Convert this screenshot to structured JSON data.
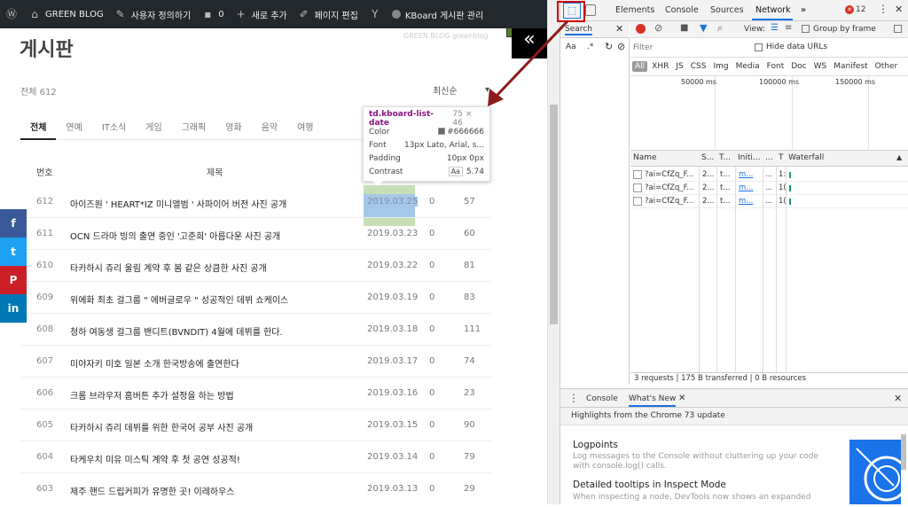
{
  "adminbar": {
    "items": [
      {
        "icon": "wordpress-icon",
        "label": ""
      },
      {
        "icon": "home-icon",
        "label": "GREEN BLOG"
      },
      {
        "icon": "brush-icon",
        "label": "사용자 정의하기"
      },
      {
        "icon": "comment-icon",
        "label": "0"
      },
      {
        "icon": "plus-icon",
        "label": "새로 추가"
      },
      {
        "icon": "pencil-icon",
        "label": "페이지 편집"
      },
      {
        "icon": "yoast-icon",
        "label": ""
      },
      {
        "icon": "dot-icon",
        "label": "KBoard 게시판 관리"
      }
    ]
  },
  "page": {
    "title": "게시판",
    "subtitle": "GREEN BLOG greenblog",
    "logo_glyph": "«",
    "total": "전체 612",
    "sort_label": "최신순",
    "sort_arrow": "▾",
    "tabs": [
      "전체",
      "연예",
      "IT소식",
      "게임",
      "그래픽",
      "영화",
      "음악",
      "여행"
    ],
    "table_headers": {
      "num": "번호",
      "title": "제목"
    },
    "rows": [
      {
        "num": "612",
        "title": "아이즈원 ' HEART*IZ 미니앨범 ' 사파이어 버전 사진 공개",
        "date": "2019.03.25",
        "views": "0",
        "likes": "57"
      },
      {
        "num": "611",
        "title": "OCN 드라마 빙의 출연 중인 '고준희' 아름다운 사진 공개",
        "date": "2019.03.23",
        "views": "0",
        "likes": "60"
      },
      {
        "num": "610",
        "title": "타카하시 쥬리 울림 계약 후 봄 같은 상큼한 사진 공개",
        "date": "2019.03.22",
        "views": "0",
        "likes": "81"
      },
      {
        "num": "609",
        "title": "위에화 최초 걸그룹 \" 에버글로우 \" 성공적인 데뷔 쇼케이스",
        "date": "2019.03.19",
        "views": "0",
        "likes": "83"
      },
      {
        "num": "608",
        "title": "청하 여동생 걸그룹 밴디트(BVNDIT) 4월에 데뷔를 한다.",
        "date": "2019.03.18",
        "views": "0",
        "likes": "111"
      },
      {
        "num": "607",
        "title": "미야자키 미호 일본 소개 한국방송에 출연한다",
        "date": "2019.03.17",
        "views": "0",
        "likes": "74"
      },
      {
        "num": "606",
        "title": "크롬 브라우저 홈버튼 추가 설정을 하는 방법",
        "date": "2019.03.16",
        "views": "0",
        "likes": "23"
      },
      {
        "num": "605",
        "title": "타카하시 쥬리 데뷔를 위한 한국어 공부 사진 공개",
        "date": "2019.03.15",
        "views": "0",
        "likes": "90"
      },
      {
        "num": "604",
        "title": "타케우치 미유 미스틱 계약 후 첫 공연 성공적!",
        "date": "2019.03.14",
        "views": "0",
        "likes": "79"
      },
      {
        "num": "603",
        "title": "제주 핸드 드립커피가 유명한 곳! 이레하우스",
        "date": "2019.03.13",
        "views": "0",
        "likes": "29"
      }
    ]
  },
  "tooltip": {
    "selector": "td.kboard-list-date",
    "size": "75 × 46",
    "color_label": "Color",
    "color_value": "#666666",
    "font_label": "Font",
    "font_value": "13px Lato, Arial, s...",
    "padding_label": "Padding",
    "padding_value": "10px 0px",
    "contrast_label": "Contrast",
    "contrast_aa": "Aa",
    "contrast_value": "5.74"
  },
  "social": [
    {
      "icon": "facebook-icon",
      "glyph": "f",
      "color": "#3b5998"
    },
    {
      "icon": "twitter-icon",
      "glyph": "t",
      "color": "#1da1f2"
    },
    {
      "icon": "pinterest-icon",
      "glyph": "P",
      "color": "#cb2027"
    },
    {
      "icon": "linkedin-icon",
      "glyph": "in",
      "color": "#0077b5"
    }
  ],
  "devtools": {
    "tabs": [
      "Elements",
      "Console",
      "Sources",
      "Network"
    ],
    "more": "»",
    "error_count": "12",
    "search_tab": "Search",
    "search_aa": "Aa",
    "search_regex": ".*",
    "view_label": "View:",
    "group_by_frame": "Group by frame",
    "filter_placeholder": "Filter",
    "hide_data_urls": "Hide data URLs",
    "filter_chips": [
      "All",
      "XHR",
      "JS",
      "CSS",
      "Img",
      "Media",
      "Font",
      "Doc",
      "WS",
      "Manifest",
      "Other"
    ],
    "timeline_labels": [
      "50000 ms",
      "100000 ms",
      "150000 ms"
    ],
    "columns": [
      "Name",
      "S...",
      "T...",
      "Initi...",
      "...",
      "T",
      "Waterfall"
    ],
    "requests": [
      {
        "name": "?ai=CfZq_F...",
        "s": "2...",
        "t": "t...",
        "init": "m...",
        "dots": "...",
        "time": "1:"
      },
      {
        "name": "?ai=CfZq_F...",
        "s": "2...",
        "t": "t...",
        "init": "m...",
        "dots": "...",
        "time": "1("
      },
      {
        "name": "?ai=CfZq_F...",
        "s": "2...",
        "t": "t...",
        "init": "m...",
        "dots": "...",
        "time": "1("
      }
    ],
    "status": "3 requests | 175 B transferred | 0 B resources",
    "drawer_tabs": [
      "Console",
      "What's New"
    ],
    "drawer_banner": "Highlights from the Chrome 73 update",
    "logpoints_title": "Logpoints",
    "logpoints_body": "Log messages to the Console without cluttering up your code with console.log() calls.",
    "tooltips_title": "Detailed tooltips in Inspect Mode",
    "tooltips_body": "When inspecting a node, DevTools now shows an expanded"
  }
}
